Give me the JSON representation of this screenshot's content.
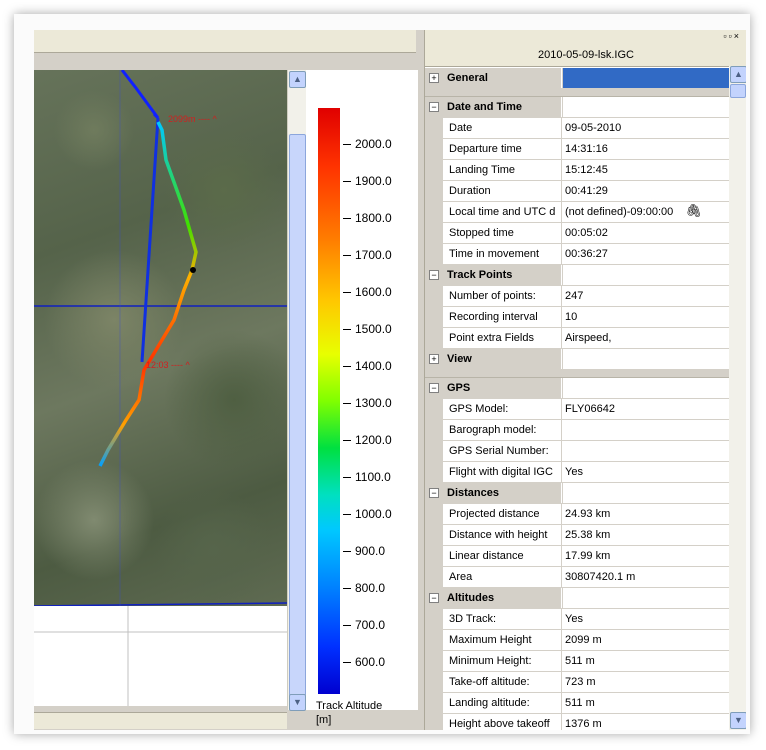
{
  "file_title": "2010-05-09-lsk.IGC",
  "window_buttons": [
    "▫",
    "▫",
    "×"
  ],
  "map": {
    "labels": [
      {
        "text": "2099m ---- ^"
      },
      {
        "text": "12:03 ---- ^"
      }
    ]
  },
  "scale": {
    "ticks": [
      "2000.0",
      "1900.0",
      "1800.0",
      "1700.0",
      "1600.0",
      "1500.0",
      "1400.0",
      "1300.0",
      "1200.0",
      "1100.0",
      "1000.0",
      "900.0",
      "800.0",
      "700.0",
      "600.0"
    ],
    "label": "Track Altitude\n[m]"
  },
  "sections": [
    {
      "name": "General",
      "expanded": false,
      "selected": true,
      "rows": []
    },
    {
      "name": "Date and Time",
      "expanded": true,
      "rows": [
        {
          "label": "Date",
          "value": "09-05-2010"
        },
        {
          "label": "Departure time",
          "value": "14:31:16"
        },
        {
          "label": "Landing Time",
          "value": "15:12:45"
        },
        {
          "label": "Duration",
          "value": "00:41:29"
        },
        {
          "label": "Local time and UTC d",
          "value": "(not defined)-09:00:00",
          "icon": "paperclip-icon"
        },
        {
          "label": "Stopped time",
          "value": "00:05:02"
        },
        {
          "label": "Time in movement",
          "value": "00:36:27"
        }
      ]
    },
    {
      "name": "Track Points",
      "expanded": true,
      "rows": [
        {
          "label": "Number of points:",
          "value": "247"
        },
        {
          "label": "Recording interval",
          "value": "10"
        },
        {
          "label": "Point extra Fields",
          "value": "Airspeed,"
        }
      ]
    },
    {
      "name": "View",
      "expanded": false,
      "rows": []
    },
    {
      "name": "GPS",
      "expanded": true,
      "rows": [
        {
          "label": "GPS Model:",
          "value": "FLY06642"
        },
        {
          "label": "Barograph model:",
          "value": ""
        },
        {
          "label": "GPS Serial Number:",
          "value": ""
        },
        {
          "label": "Flight with digital IGC",
          "value": "Yes"
        }
      ]
    },
    {
      "name": "Distances",
      "expanded": true,
      "rows": [
        {
          "label": "Projected distance",
          "value": "24.93 km"
        },
        {
          "label": "Distance with height",
          "value": "25.38 km"
        },
        {
          "label": "Linear distance",
          "value": "17.99 km"
        },
        {
          "label": "Area",
          "value": "30807420.1 m"
        }
      ]
    },
    {
      "name": "Altitudes",
      "expanded": true,
      "rows": [
        {
          "label": "3D Track:",
          "value": "Yes"
        },
        {
          "label": "Maximum Height",
          "value": "2099 m"
        },
        {
          "label": "Minimum Height:",
          "value": "511 m"
        },
        {
          "label": "Take-off altitude:",
          "value": "723 m"
        },
        {
          "label": "Landing altitude:",
          "value": "511 m"
        },
        {
          "label": "Height above takeoff",
          "value": "1376 m"
        }
      ]
    }
  ]
}
